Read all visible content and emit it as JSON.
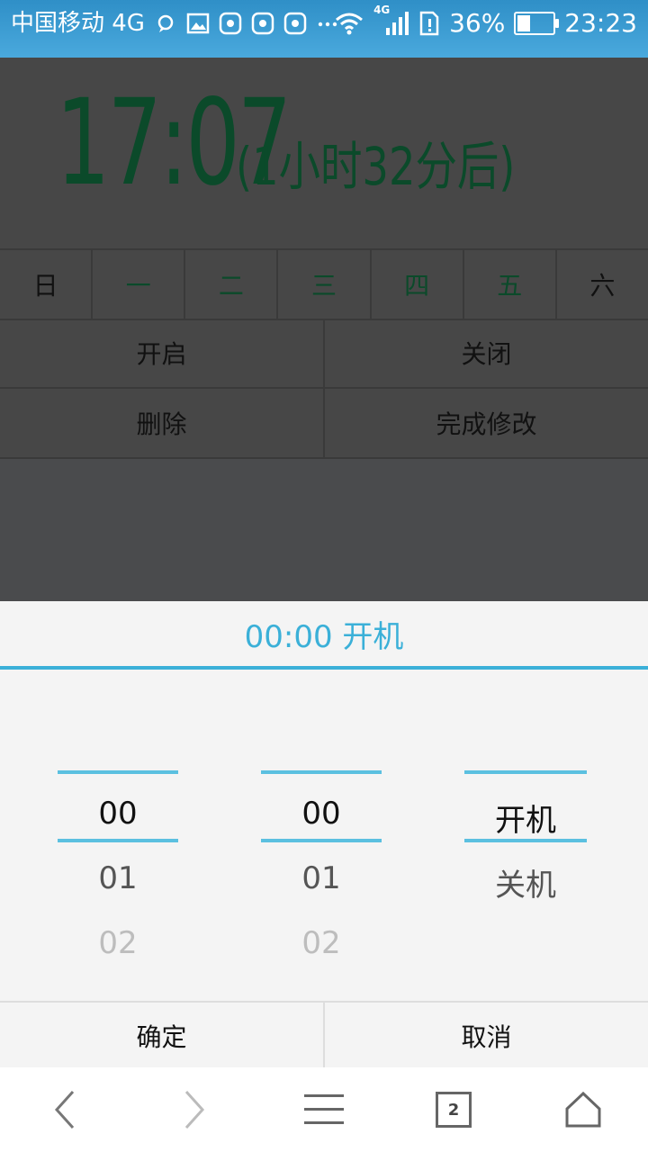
{
  "status_bar": {
    "carrier": "中国移动 4G",
    "network_badge": "4G",
    "battery": "36%",
    "battery_level": 0.36,
    "time": "23:23"
  },
  "alarm": {
    "time": "17:07",
    "relative": "(1小时32分后)"
  },
  "weekdays": [
    {
      "label": "日",
      "active": false
    },
    {
      "label": "一",
      "active": true
    },
    {
      "label": "二",
      "active": true
    },
    {
      "label": "三",
      "active": true
    },
    {
      "label": "四",
      "active": true
    },
    {
      "label": "五",
      "active": true
    },
    {
      "label": "六",
      "active": false
    }
  ],
  "actions": {
    "enable": "开启",
    "disable": "关闭",
    "delete": "删除",
    "finish": "完成修改"
  },
  "picker": {
    "title": "00:00 开机",
    "hours": [
      "00",
      "01",
      "02"
    ],
    "minutes": [
      "00",
      "01",
      "02"
    ],
    "modes": [
      "开机",
      "关机"
    ],
    "confirm": "确定",
    "cancel": "取消",
    "accent": "#3bb0d8"
  },
  "nav": {
    "tab_count": "2"
  }
}
